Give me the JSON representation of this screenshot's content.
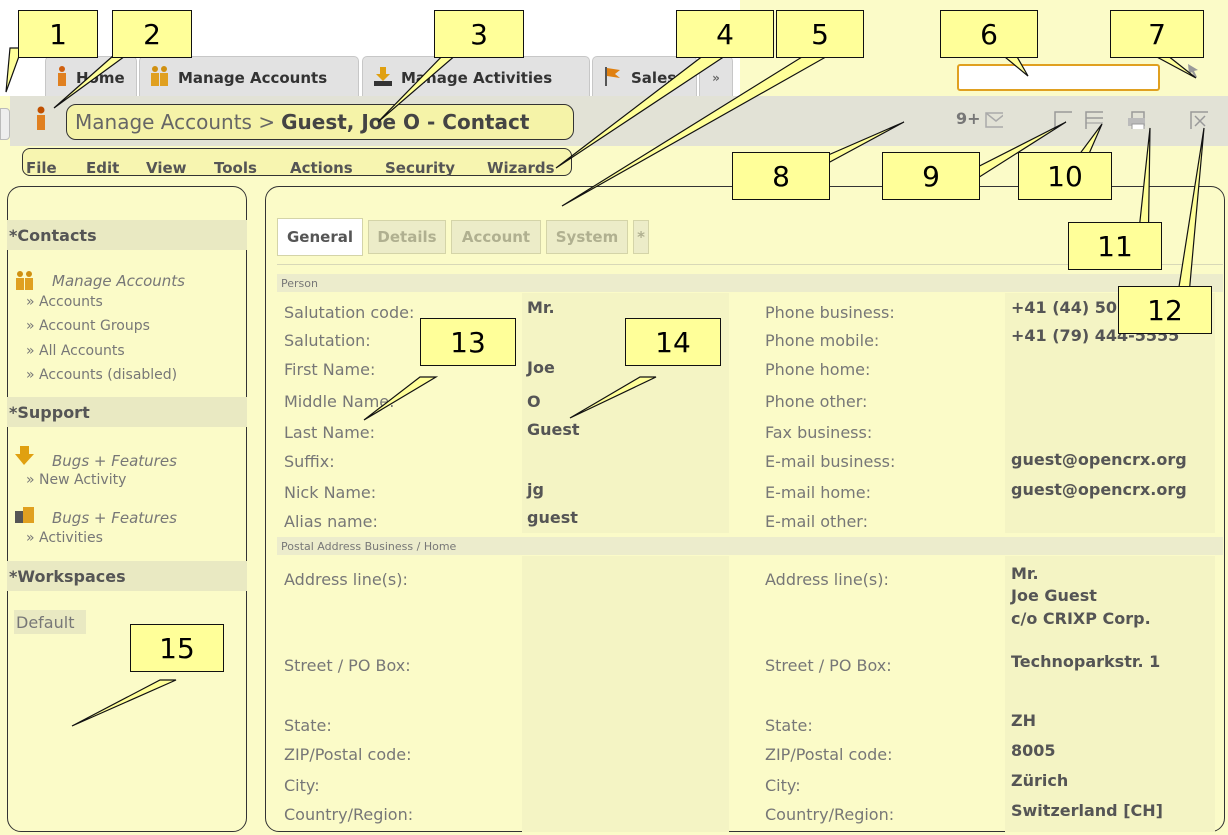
{
  "tabs": [
    {
      "label": "Home"
    },
    {
      "label": "Manage Accounts"
    },
    {
      "label": "Manage Activities"
    },
    {
      "label": "Sales"
    },
    {
      "label": "»"
    }
  ],
  "search": {
    "value": ""
  },
  "breadcrumb": {
    "path": "Manage Accounts >",
    "current": "Guest, Joe O - Contact"
  },
  "toolbar": {
    "notification_count": "9+"
  },
  "menu": [
    "File",
    "Edit",
    "View",
    "Tools",
    "Actions",
    "Security",
    "Wizards"
  ],
  "sidebar": {
    "sections": [
      {
        "title": "*Contacts"
      },
      {
        "title": "*Support"
      },
      {
        "title": "*Workspaces"
      }
    ],
    "contacts_heading": "Manage Accounts",
    "contacts_links": [
      "» Accounts",
      "» Account Groups",
      "» All Accounts",
      "» Accounts (disabled)"
    ],
    "support_items": [
      {
        "heading": "Bugs + Features",
        "link": "» New Activity"
      },
      {
        "heading": "Bugs + Features",
        "link": "» Activities"
      }
    ],
    "workspace": "Default"
  },
  "content_tabs": [
    "General",
    "Details",
    "Account",
    "System",
    "*"
  ],
  "sections": {
    "person": "Person",
    "postal": "Postal Address Business / Home"
  },
  "person_left": [
    {
      "label": "Salutation code:",
      "value": "Mr."
    },
    {
      "label": "Salutation:",
      "value": ""
    },
    {
      "label": "First Name:",
      "value": "Joe"
    },
    {
      "label": "Middle Name:",
      "value": "O"
    },
    {
      "label": "Last Name:",
      "value": "Guest"
    },
    {
      "label": "Suffix:",
      "value": ""
    },
    {
      "label": "Nick Name:",
      "value": "jg"
    },
    {
      "label": "Alias name:",
      "value": "guest"
    }
  ],
  "person_right": [
    {
      "label": "Phone business:",
      "value": "+41 (44) 50"
    },
    {
      "label": "Phone mobile:",
      "value": "+41 (79) 444-5555"
    },
    {
      "label": "Phone home:",
      "value": ""
    },
    {
      "label": "Phone other:",
      "value": ""
    },
    {
      "label": "Fax business:",
      "value": ""
    },
    {
      "label": "E-mail business:",
      "value": "guest@opencrx.org"
    },
    {
      "label": "E-mail home:",
      "value": "guest@opencrx.org"
    },
    {
      "label": "E-mail other:",
      "value": ""
    }
  ],
  "address_left": [
    {
      "label": "Address line(s):"
    },
    {
      "label": "Street / PO Box:"
    },
    {
      "label": "State:"
    },
    {
      "label": "ZIP/Postal code:"
    },
    {
      "label": "City:"
    },
    {
      "label": "Country/Region:"
    }
  ],
  "address_right": [
    {
      "label": "Address line(s):",
      "lines": [
        "Mr.",
        "Joe Guest",
        "c/o CRIXP Corp."
      ]
    },
    {
      "label": "Street / PO Box:",
      "value": "Technoparkstr. 1"
    },
    {
      "label": "State:",
      "value": "ZH"
    },
    {
      "label": "ZIP/Postal code:",
      "value": "8005"
    },
    {
      "label": "City:",
      "value": "Zürich"
    },
    {
      "label": "Country/Region:",
      "value": "Switzerland [CH]"
    }
  ],
  "callouts": [
    "1",
    "2",
    "3",
    "4",
    "5",
    "6",
    "7",
    "8",
    "9",
    "10",
    "11",
    "12",
    "13",
    "14",
    "15"
  ],
  "colors": {
    "callout": "#ffff99",
    "background": "#fbfbc8",
    "titlebar": "#e2e2d6",
    "search_border": "#e0a020"
  }
}
